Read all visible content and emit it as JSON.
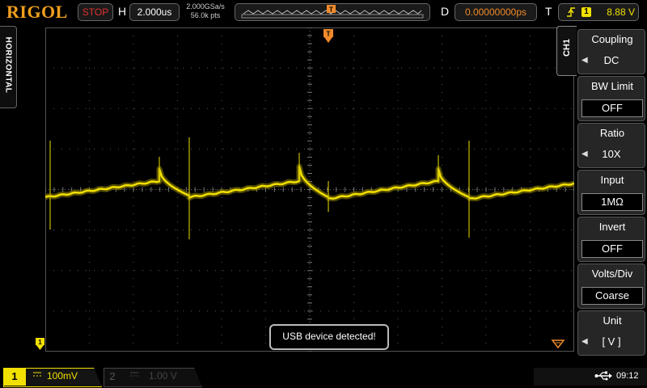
{
  "brand": "RIGOL",
  "top": {
    "run_state": "STOP",
    "h_label": "H",
    "timebase": "2.000us",
    "sample_rate": "2.000GSa/s",
    "mem_depth": "56.0k pts",
    "d_label": "D",
    "delay": "0.00000000ps",
    "t_label": "T",
    "trigger_channel": "1",
    "trigger_level": "8.88 V"
  },
  "side": {
    "horizontal_label": "HORIZONTAL",
    "channel_tab": "CH1"
  },
  "menu": [
    {
      "title": "Coupling",
      "value": "DC",
      "boxed": false,
      "arrow": true
    },
    {
      "title": "BW Limit",
      "value": "OFF",
      "boxed": true,
      "arrow": false
    },
    {
      "title": "Ratio",
      "value": "10X",
      "boxed": false,
      "arrow": true
    },
    {
      "title": "Input",
      "value": "1MΩ",
      "boxed": true,
      "arrow": false
    },
    {
      "title": "Invert",
      "value": "OFF",
      "boxed": true,
      "arrow": false
    },
    {
      "title": "Volts/Div",
      "value": "Coarse",
      "boxed": true,
      "arrow": false
    },
    {
      "title": "Unit",
      "value": "[  V  ]",
      "boxed": false,
      "arrow": true
    }
  ],
  "bottom": {
    "ch1_number": "1",
    "ch1_scale": "100mV",
    "ch2_number": "2",
    "ch2_scale": "1.00 V",
    "time": "09:12"
  },
  "toast": "USB device detected!",
  "colors": {
    "channel1": "#f2e000",
    "brand": "#f0a01e",
    "trigger_marker": "#f08a2a",
    "stop": "#e23030"
  },
  "icons": {
    "coupling_symbol": "dc-coupling-icon",
    "trigger_edge": "rising-edge-icon",
    "usb": "usb-icon"
  }
}
